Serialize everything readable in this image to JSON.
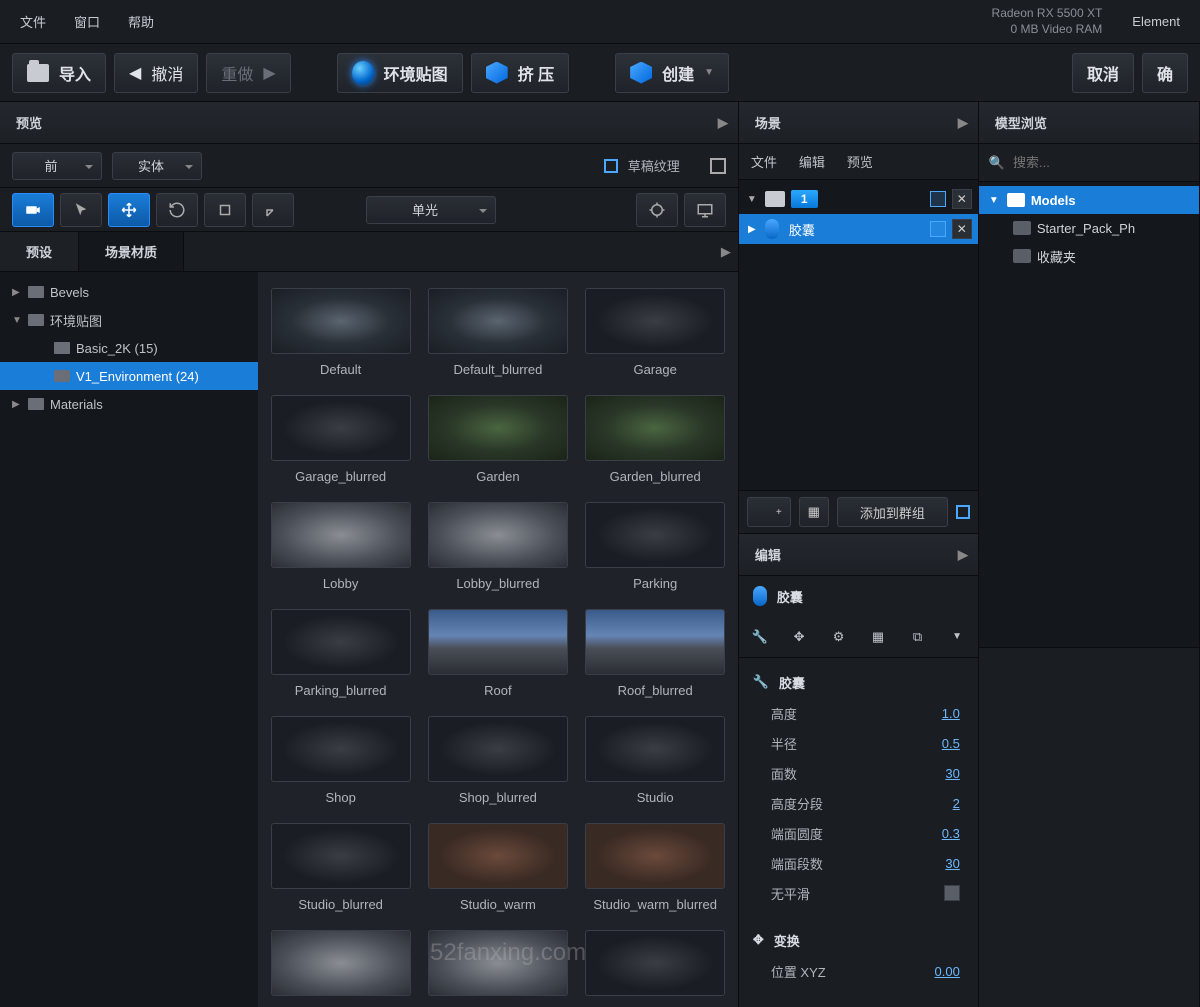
{
  "menu": {
    "file": "文件",
    "window": "窗口",
    "help": "帮助"
  },
  "gpu": {
    "name": "Radeon RX 5500 XT",
    "ram": "0 MB Video RAM"
  },
  "element": "Element",
  "toolbar": {
    "import": "导入",
    "undo": "撤消",
    "redo": "重做",
    "env": "环境贴图",
    "extrude": "挤 压",
    "create": "创建",
    "cancel": "取消",
    "ok": "确"
  },
  "preview": {
    "title": "预览",
    "view": "前",
    "shade": "实体",
    "draft": "草稿纹理",
    "light": "单光"
  },
  "tabs": {
    "presets": "预设",
    "sceneMat": "场景材质"
  },
  "tree": {
    "bevels": "Bevels",
    "env": "环境贴图",
    "basic": "Basic_2K (15)",
    "v1": "V1_Environment (24)",
    "materials": "Materials"
  },
  "thumbs": [
    {
      "label": "Default",
      "cls": ""
    },
    {
      "label": "Default_blurred",
      "cls": ""
    },
    {
      "label": "Garage",
      "cls": "dark"
    },
    {
      "label": "Garage_blurred",
      "cls": "dark"
    },
    {
      "label": "Garden",
      "cls": "garden"
    },
    {
      "label": "Garden_blurred",
      "cls": "garden"
    },
    {
      "label": "Lobby",
      "cls": "lobby"
    },
    {
      "label": "Lobby_blurred",
      "cls": "lobby"
    },
    {
      "label": "Parking",
      "cls": "dark"
    },
    {
      "label": "Parking_blurred",
      "cls": "dark"
    },
    {
      "label": "Roof",
      "cls": "sky"
    },
    {
      "label": "Roof_blurred",
      "cls": "sky"
    },
    {
      "label": "Shop",
      "cls": "dark"
    },
    {
      "label": "Shop_blurred",
      "cls": "dark"
    },
    {
      "label": "Studio",
      "cls": "dark"
    },
    {
      "label": "Studio_blurred",
      "cls": "dark"
    },
    {
      "label": "Studio_warm",
      "cls": "warm"
    },
    {
      "label": "Studio_warm_blurred",
      "cls": "warm"
    },
    {
      "label": "",
      "cls": "lobby"
    },
    {
      "label": "",
      "cls": "lobby"
    },
    {
      "label": "",
      "cls": "dark"
    }
  ],
  "scene": {
    "title": "场景",
    "menus": {
      "file": "文件",
      "edit": "编辑",
      "preview": "预览"
    },
    "group_badge": "1",
    "obj": "胶囊",
    "addGroup": "添加到群组"
  },
  "edit": {
    "title": "编辑",
    "obj": "胶囊",
    "section": "胶囊",
    "props": [
      {
        "k": "高度",
        "v": "1.0"
      },
      {
        "k": "半径",
        "v": "0.5"
      },
      {
        "k": "面数",
        "v": "30"
      },
      {
        "k": "高度分段",
        "v": "2"
      },
      {
        "k": "端面圆度",
        "v": "0.3"
      },
      {
        "k": "端面段数",
        "v": "30"
      }
    ],
    "noSmooth": "无平滑",
    "transform": "变换",
    "posLabel": "位置 XYZ",
    "posVal": "0.00"
  },
  "models": {
    "title": "模型浏览",
    "searchPlaceholder": "搜索...",
    "root": "Models",
    "starter": "Starter_Pack_Ph",
    "fav": "收藏夹"
  },
  "watermark": "52fanxing.com"
}
